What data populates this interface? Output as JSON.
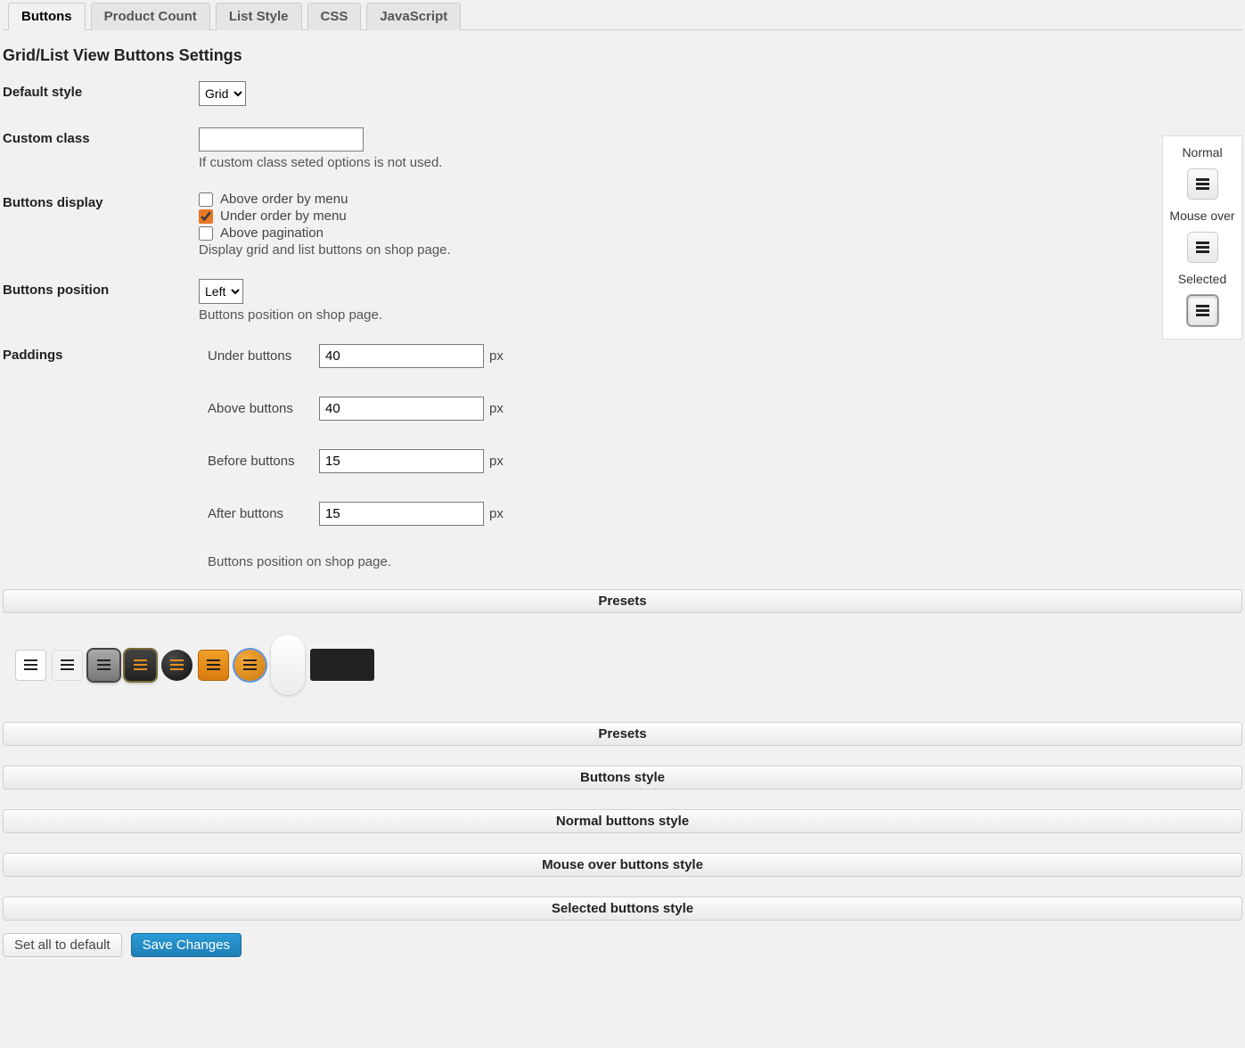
{
  "tabs": {
    "buttons": "Buttons",
    "product_count": "Product Count",
    "list_style": "List Style",
    "css": "CSS",
    "javascript": "JavaScript"
  },
  "section_title": "Grid/List View Buttons Settings",
  "default_style": {
    "label": "Default style",
    "value": "Grid"
  },
  "custom_class": {
    "label": "Custom class",
    "value": "",
    "desc": "If custom class seted options is not used."
  },
  "buttons_display": {
    "label": "Buttons display",
    "opt_above_order": "Above order by menu",
    "opt_under_order": "Under order by menu",
    "opt_above_pagination": "Above pagination",
    "desc": "Display grid and list buttons on shop page."
  },
  "buttons_position": {
    "label": "Buttons position",
    "value": "Left",
    "desc": "Buttons position on shop page."
  },
  "paddings": {
    "label": "Paddings",
    "under": {
      "label": "Under buttons",
      "value": "40",
      "unit": "px"
    },
    "above": {
      "label": "Above buttons",
      "value": "40",
      "unit": "px"
    },
    "before": {
      "label": "Before buttons",
      "value": "15",
      "unit": "px"
    },
    "after": {
      "label": "After buttons",
      "value": "15",
      "unit": "px"
    },
    "desc": "Buttons position on shop page."
  },
  "accordions": {
    "presets1": "Presets",
    "presets2": "Presets",
    "buttons_style": "Buttons style",
    "normal_style": "Normal buttons style",
    "mouseover_style": "Mouse over buttons style",
    "selected_style": "Selected buttons style"
  },
  "preview": {
    "normal": "Normal",
    "mouseover": "Mouse over",
    "selected": "Selected"
  },
  "footer": {
    "reset": "Set all to default",
    "save": "Save Changes"
  }
}
